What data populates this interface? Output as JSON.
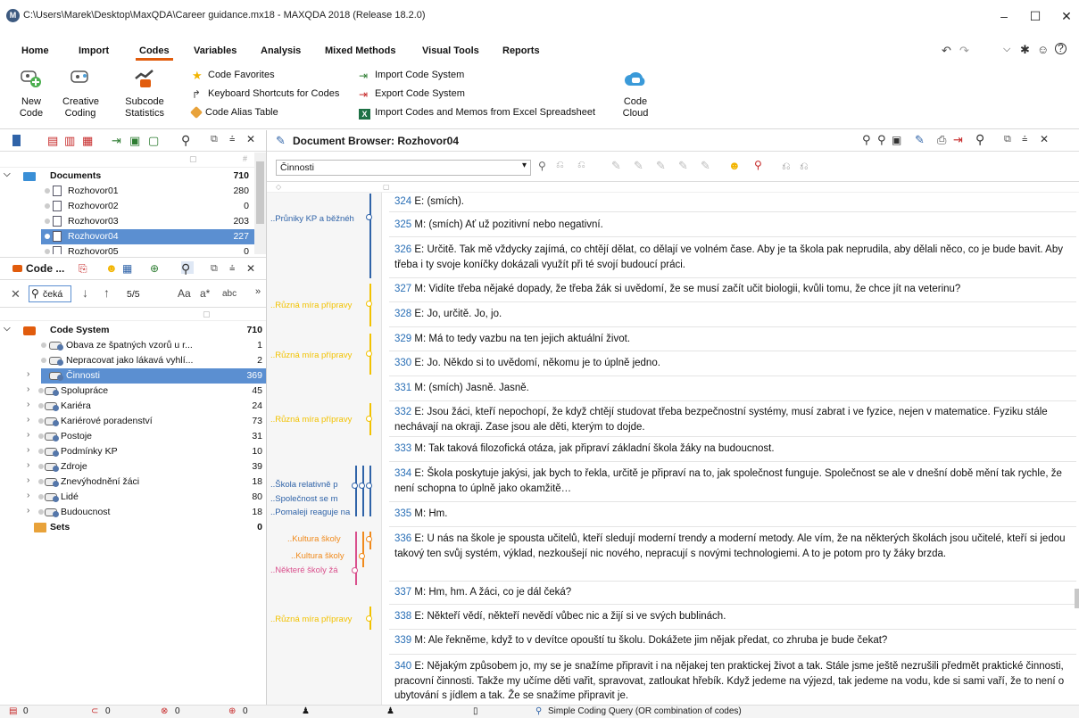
{
  "window": {
    "title": "C:\\Users\\Marek\\Desktop\\MaxQDA\\Career guidance.mx18 - MAXQDA 2018 (Release 18.2.0)",
    "logo": "M"
  },
  "menu": [
    "Home",
    "Import",
    "Codes",
    "Variables",
    "Analysis",
    "Mixed Methods",
    "Visual Tools",
    "Reports"
  ],
  "menu_active": "Codes",
  "ribbon": {
    "new_code": "New\nCode",
    "creative_coding": "Creative\nCoding",
    "subcode_statistics": "Subcode\nStatistics",
    "code_favorites": "Code Favorites",
    "keyboard_shortcuts": "Keyboard Shortcuts for Codes",
    "code_alias_table": "Code Alias Table",
    "import_code_system": "Import Code System",
    "export_code_system": "Export Code System",
    "import_codes_excel": "Import Codes and Memos from Excel Spreadsheet",
    "code_cloud": "Code\nCloud"
  },
  "documents": {
    "header": "Documents",
    "count": "710",
    "items": [
      {
        "name": "Rozhovor01",
        "count": "280"
      },
      {
        "name": "Rozhovor02",
        "count": "0"
      },
      {
        "name": "Rozhovor03",
        "count": "203"
      },
      {
        "name": "Rozhovor04",
        "count": "227"
      },
      {
        "name": "Rozhovor05",
        "count": "0"
      }
    ]
  },
  "code_panel": {
    "title": "Code ...",
    "search_value": "čeká",
    "search_result": "5/5",
    "aa": "Aa",
    "astar": "a*",
    "abc": "abc",
    "root": "Code System",
    "root_count": "710",
    "codes": [
      {
        "name": "Obava ze špatných vzorů u r...",
        "count": "1"
      },
      {
        "name": "Nepracovat jako lákavá vyhlí...",
        "count": "2"
      },
      {
        "name": "Činnosti",
        "count": "369"
      },
      {
        "name": "Spolupráce",
        "count": "45"
      },
      {
        "name": "Kariéra",
        "count": "24"
      },
      {
        "name": "Kariérové poradenství",
        "count": "73"
      },
      {
        "name": "Postoje",
        "count": "31"
      },
      {
        "name": "Podmínky KP",
        "count": "10"
      },
      {
        "name": "Zdroje",
        "count": "39"
      },
      {
        "name": "Znevýhodnění žáci",
        "count": "18"
      },
      {
        "name": "Lidé",
        "count": "80"
      },
      {
        "name": "Budoucnost",
        "count": "18"
      }
    ],
    "sets": "Sets",
    "sets_count": "0"
  },
  "doc_browser": {
    "title": "Document Browser: Rozhovor04",
    "code_select": "Činnosti",
    "paragraphs": [
      {
        "n": "324",
        "t": "E: (smích)."
      },
      {
        "n": "325",
        "t": "M: (smích) Ať už pozitivní nebo negativní."
      },
      {
        "n": "326",
        "t": "E: Určitě. Tak mě vždycky zajímá, co chtějí dělat, co dělají ve volném čase. Aby je ta škola pak neprudila, aby dělali něco, co je bude bavit. Aby třeba i ty svoje koníčky dokázali využít při té svojí budoucí práci."
      },
      {
        "n": "327",
        "t": "M: Vidíte třeba nějaké dopady, že třeba žák si uvědomí, že se musí začít učit biologii, kvůli tomu, že chce jít na veterinu?"
      },
      {
        "n": "328",
        "t": "E: Jo, určitě. Jo, jo."
      },
      {
        "n": "329",
        "t": "M: Má to tedy vazbu na ten jejich aktuální život."
      },
      {
        "n": "330",
        "t": "E: Jo. Někdo si to uvědomí, někomu je to úplně jedno."
      },
      {
        "n": "331",
        "t": "M: (smích) Jasně. Jasně."
      },
      {
        "n": "332",
        "t": "E: Jsou žáci, kteří nepochopí, že když chtějí studovat třeba bezpečnostní systémy, musí zabrat i ve fyzice, nejen v matematice. Fyziku stále nechávají na okraji. Zase jsou ale děti, kterým to dojde."
      },
      {
        "n": "333",
        "t": "M: Tak taková filozofická otáza, jak připraví základní škola žáky na budoucnost."
      },
      {
        "n": "334",
        "t": "E: Škola poskytuje jakýsi, jak bych to řekla, určitě je připraví na to, jak společnost funguje. Společnost se ale v dnešní době mění tak rychle, že není schopna to úplně jako okamžitě…"
      },
      {
        "n": "335",
        "t": "M: Hm."
      },
      {
        "n": "336",
        "t": "E: U nás na škole je spousta učitelů, kteří sledují moderní trendy a moderní metody. Ale vím, že na některých školách jsou učitelé, kteří si jedou takový ten svůj systém, výklad, nezkoušejí nic nového, nepracují s novými technologiemi. A to je potom pro ty žáky brzda."
      },
      {
        "n": "337",
        "t": "M: Hm, hm. A žáci, co je dál čeká?"
      },
      {
        "n": "338",
        "t": "E: Někteří vědí, někteří nevědí vůbec nic a žijí si ve svých bublinách."
      },
      {
        "n": "339",
        "t": "M: Ale řekněme, když to v devítce opouští tu školu. Dokážete jim nějak předat, co zhruba je bude čekat?"
      },
      {
        "n": "340",
        "t": "E: Nějakým způsobem jo, my se je snažíme připravit i na nějakej ten praktickej život a tak. Stále jsme ještě nezrušili předmět praktické činnosti, pracovní činnosti. Takže my učíme děti vařit, spravovat, zatloukat hřebík. Když jedeme na výjezd, tak jedeme na vodu, kde si sami vaří, že to není o ubytování s jídlem a tak. Že se snažíme připravit je."
      }
    ],
    "memos": [
      "..Průniky KP a běžnéh",
      "..Různá míra přípravy",
      "..Různá míra přípravy",
      "..Různá míra přípravy",
      "..Škola relativně p",
      "..Společnost se m",
      "..Pomaleji reaguje na",
      "..Kultura školy",
      "..Kultura školy",
      "..Některé školy žá",
      "..Různá míra přípravy"
    ]
  },
  "status": {
    "docs": "0",
    "codes": "0",
    "segs": "0",
    "memos": "0",
    "query": "Simple Coding Query (OR combination of codes)"
  },
  "colors": {
    "accent": "#e15c0d",
    "selection": "#5b8fd1",
    "blue_code": "#2f63a8",
    "yellow_code": "#f2c200",
    "orange_code": "#f08a1c",
    "pink_code": "#d94f8c"
  }
}
